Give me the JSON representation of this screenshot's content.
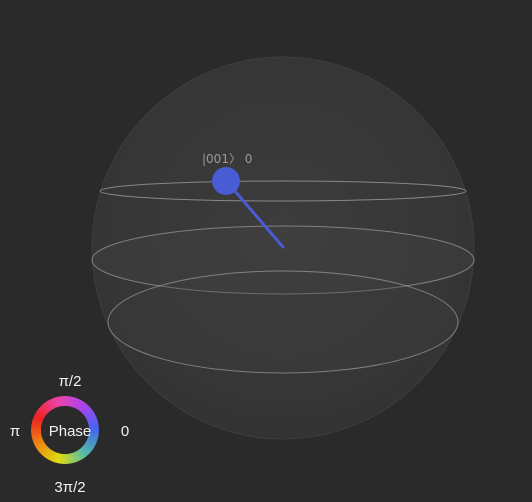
{
  "colors": {
    "background": "#2a2a2a",
    "sphere_fill": "#3a3a3a",
    "ring_stroke": "#c8c8c8",
    "state_vector": "#4a5bd6",
    "label_text": "#9a9a9a",
    "phase_text": "#f2f2f2"
  },
  "sphere": {
    "state": {
      "label": "|001〉 0"
    },
    "vector_icon": "state-vector-icon"
  },
  "phase_wheel": {
    "title": "Phase",
    "top_label": "π/2",
    "left_label": "π",
    "right_label": "0",
    "bottom_label": "3π/2",
    "gradient_colors": [
      "#4466ee",
      "#aa44ee",
      "#ee44aa",
      "#ee2222",
      "#ee8811",
      "#dddd11",
      "#55bbaa",
      "#4466ee"
    ]
  }
}
